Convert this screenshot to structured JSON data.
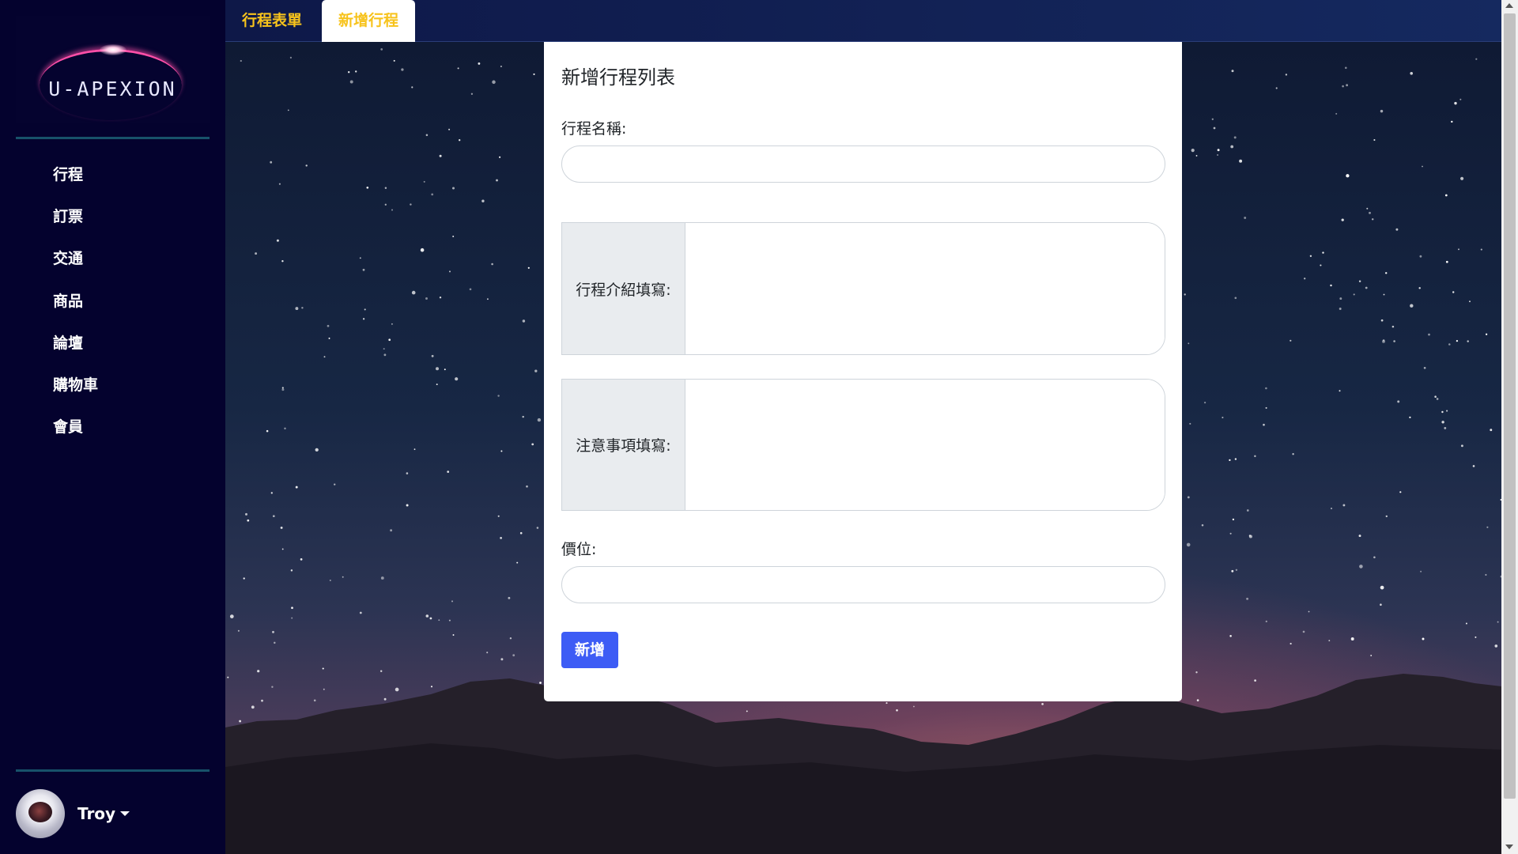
{
  "brand": {
    "logo_text": "U-APEXION"
  },
  "sidebar": {
    "items": [
      {
        "label": "行程"
      },
      {
        "label": "訂票"
      },
      {
        "label": "交通"
      },
      {
        "label": "商品"
      },
      {
        "label": "論壇"
      },
      {
        "label": "購物車"
      },
      {
        "label": "會員"
      }
    ]
  },
  "user": {
    "name": "Troy"
  },
  "tabs": [
    {
      "label": "行程表單",
      "active": false
    },
    {
      "label": "新增行程",
      "active": true
    }
  ],
  "form": {
    "title": "新增行程列表",
    "name_label": "行程名稱:",
    "name_value": "",
    "intro_label": "行程介紹填寫:",
    "intro_value": "",
    "notes_label": "注意事項填寫:",
    "notes_value": "",
    "price_label": "價位:",
    "price_value": "",
    "submit_label": "新增"
  },
  "colors": {
    "accent": "#3d5cf5",
    "tab_text": "#f7c31c",
    "sidebar_bg": "#04022e",
    "tabbar_bg": "#0e1848"
  }
}
